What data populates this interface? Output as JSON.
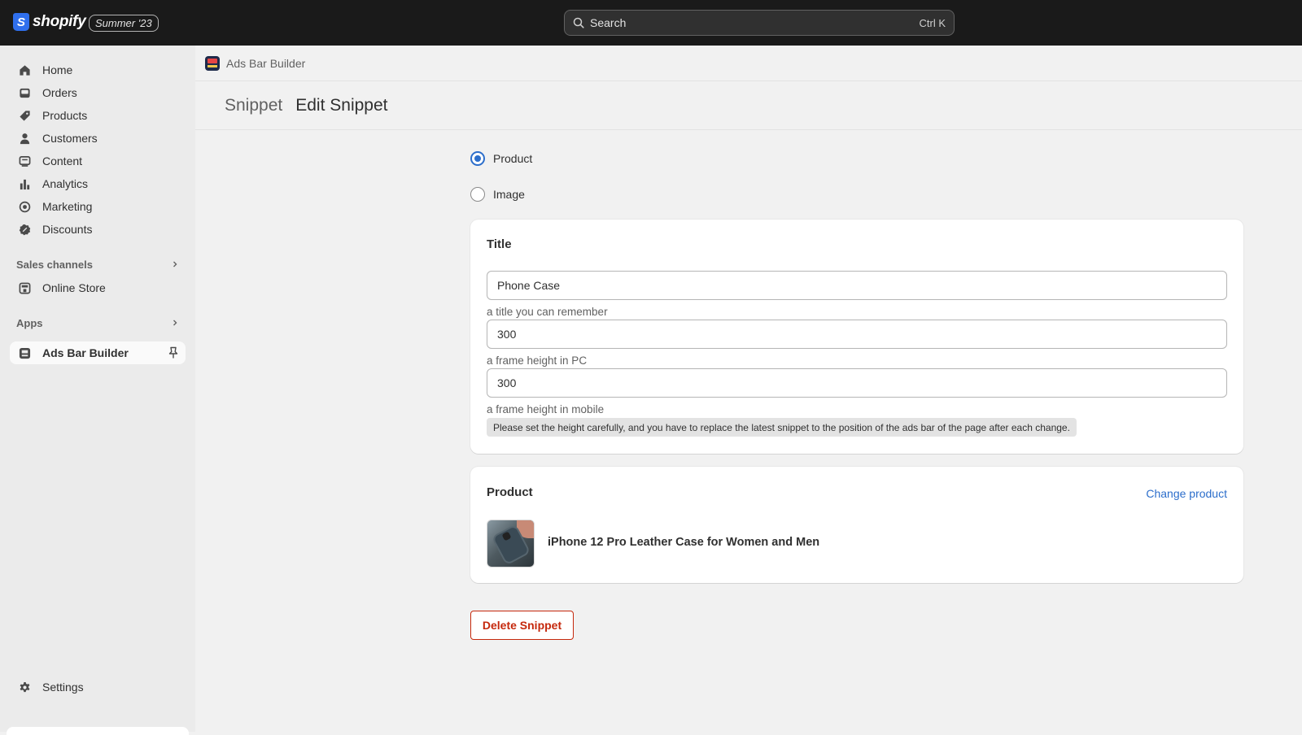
{
  "topbar": {
    "logo_text": "shopify",
    "logo_mark": "S",
    "edition": "Summer '23",
    "search_placeholder": "Search",
    "search_shortcut": "Ctrl K"
  },
  "sidebar": {
    "items": [
      {
        "label": "Home",
        "icon": "home-icon"
      },
      {
        "label": "Orders",
        "icon": "inbox-icon"
      },
      {
        "label": "Products",
        "icon": "tag-icon"
      },
      {
        "label": "Customers",
        "icon": "person-icon"
      },
      {
        "label": "Content",
        "icon": "content-icon"
      },
      {
        "label": "Analytics",
        "icon": "bar-chart-icon"
      },
      {
        "label": "Marketing",
        "icon": "target-icon"
      },
      {
        "label": "Discounts",
        "icon": "discount-icon"
      }
    ],
    "sales_channels_heading": "Sales channels",
    "online_store": "Online Store",
    "apps_heading": "Apps",
    "active_app": "Ads Bar Builder",
    "settings": "Settings"
  },
  "appbar": {
    "app_name": "Ads Bar Builder"
  },
  "page": {
    "breadcrumb": "Snippet",
    "title": "Edit Snippet"
  },
  "type_options": [
    {
      "label": "Product",
      "selected": true
    },
    {
      "label": "Image",
      "selected": false
    }
  ],
  "title_card": {
    "heading": "Title",
    "title_value": "Phone Case",
    "title_help": "a title you can remember",
    "pc_height_value": "300",
    "pc_height_help": "a frame height in PC",
    "mobile_height_value": "300",
    "mobile_height_help": "a frame height in mobile",
    "note": "Please set the height carefully, and you have to replace the latest snippet to the position of the ads bar of the page after each change."
  },
  "product_card": {
    "heading": "Product",
    "change_link": "Change product",
    "product_name": "iPhone 12 Pro Leather Case for Women and Men"
  },
  "actions": {
    "delete_label": "Delete Snippet"
  },
  "colors": {
    "accent": "#2c6ecb",
    "critical": "#c5280c",
    "topbar": "#1a1a1a"
  }
}
